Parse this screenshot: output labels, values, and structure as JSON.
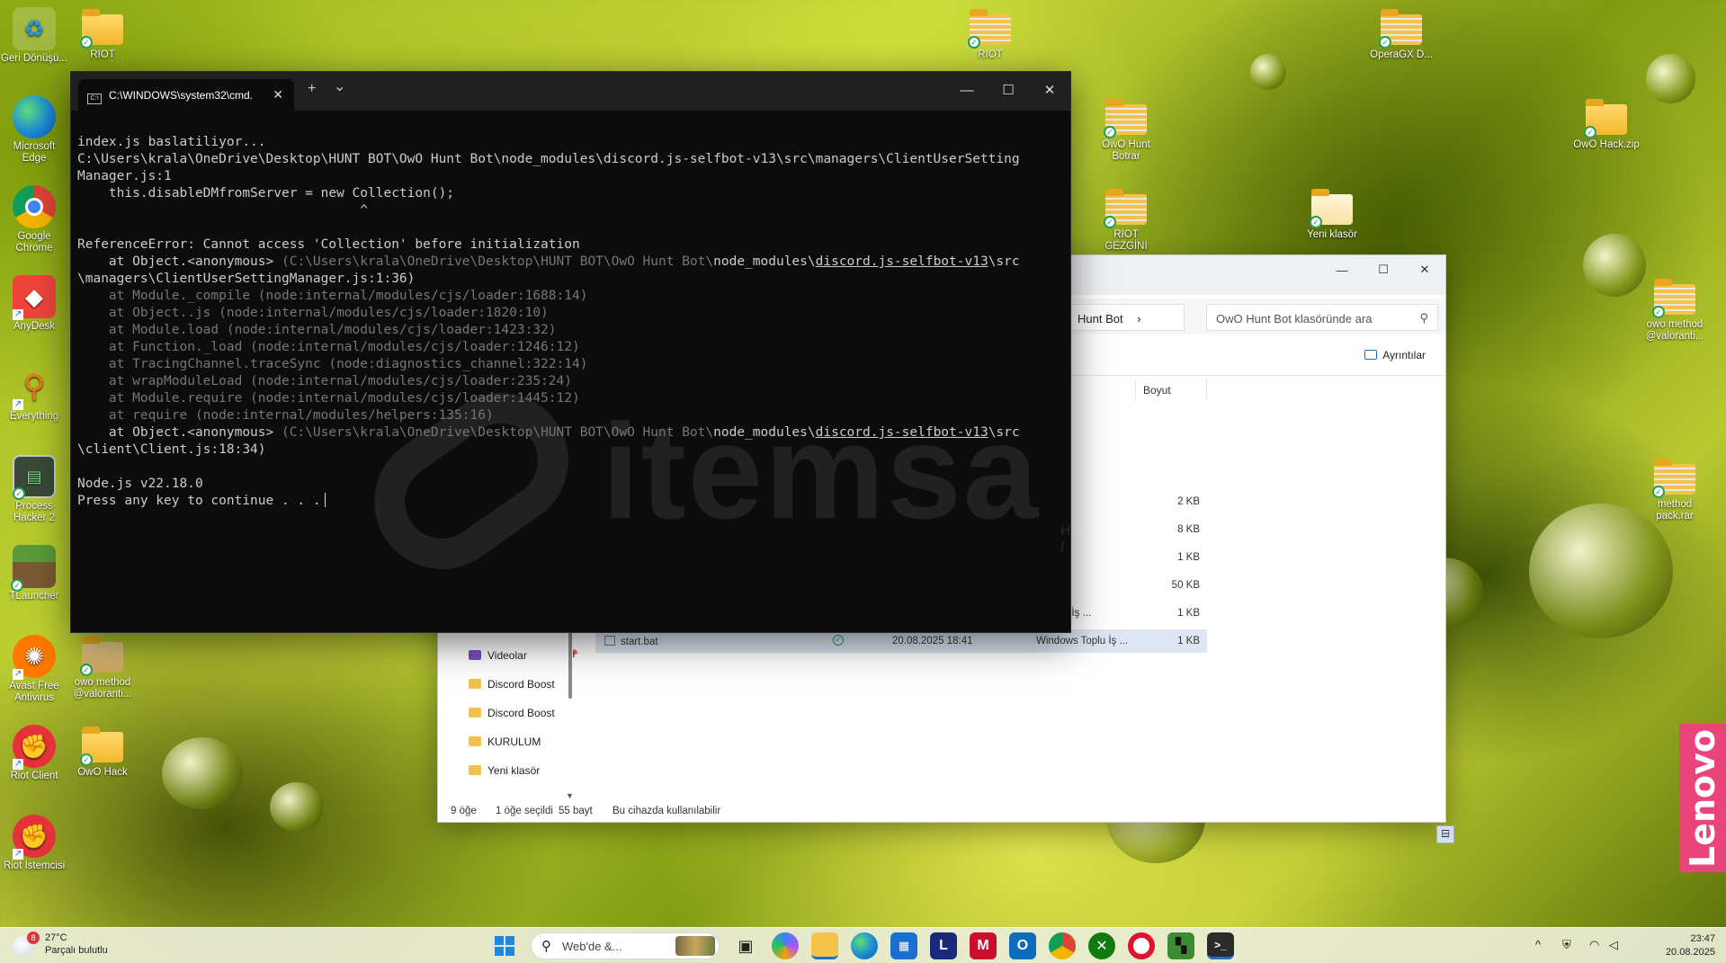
{
  "desktop": {
    "icons": [
      {
        "label": "Geri Dönüşü...",
        "kind": "recycle"
      },
      {
        "label": "Microsoft Edge",
        "kind": "edge"
      },
      {
        "label": "Google Chrome",
        "kind": "chrome"
      },
      {
        "label": "AnyDesk",
        "kind": "anydesk"
      },
      {
        "label": "Everything",
        "kind": "everything"
      },
      {
        "label": "Process Hacker 2",
        "kind": "processhacker"
      },
      {
        "label": "TLauncher",
        "kind": "tlauncher"
      },
      {
        "label": "Avast Free Antivirus",
        "kind": "avast"
      },
      {
        "label": "Riot Client",
        "kind": "riot"
      },
      {
        "label": "Riot İstemcisi",
        "kind": "riot"
      },
      {
        "label": "RIOT GEZGİNİ BOOST (1)",
        "kind": "folder"
      },
      {
        "label": "owo method @valoranti...",
        "kind": "folder"
      },
      {
        "label": "OwO Hack",
        "kind": "folder"
      },
      {
        "label": "RIOT GEZGİNİ BOOST (1).r...",
        "kind": "zip"
      },
      {
        "label": "OwO Hunt Botrar",
        "kind": "zip"
      },
      {
        "label": "RIOT GEZGİNİ BOOST (1).rar",
        "kind": "zip"
      },
      {
        "label": "Yeni klasör",
        "kind": "folder"
      },
      {
        "label": "OperaGX D...",
        "kind": "zip"
      },
      {
        "label": "OwO Hack.zip",
        "kind": "zip"
      },
      {
        "label": "owo method @valoranti...",
        "kind": "zip"
      },
      {
        "label": "method pack.rar",
        "kind": "zip"
      }
    ]
  },
  "terminal": {
    "tab_title": "C:\\WINDOWS\\system32\\cmd.",
    "tab_close": "✕",
    "new_tab": "+",
    "dropdown": "⌄",
    "minimize": "—",
    "maximize": "☐",
    "close": "✕",
    "lines": {
      "l1": "index.js baslatiliyor...",
      "l2": "C:\\Users\\krala\\OneDrive\\Desktop\\HUNT BOT\\OwO Hunt Bot\\node_modules\\discord.js-selfbot-v13\\src\\managers\\ClientUserSetting",
      "l3": "Manager.js:1",
      "l4": "    this.disableDMfromServer = new Collection();",
      "l5": "                                    ^",
      "l6": "",
      "l7": "ReferenceError: Cannot access 'Collection' before initialization",
      "l8a": "    at Object.<anonymous> ",
      "l8b": "(C:\\Users\\krala\\OneDrive\\Desktop\\HUNT BOT\\OwO Hunt Bot\\",
      "l8c": "node_modules\\",
      "l8d": "discord.js-selfbot-v13",
      "l8e": "\\src",
      "l9": "\\managers\\ClientUserSettingManager.js:1:36)",
      "l10": "    at Module._compile (node:internal/modules/cjs/loader:1688:14)",
      "l11": "    at Object..js (node:internal/modules/cjs/loader:1820:10)",
      "l12": "    at Module.load (node:internal/modules/cjs/loader:1423:32)",
      "l13": "    at Function._load (node:internal/modules/cjs/loader:1246:12)",
      "l14": "    at TracingChannel.traceSync (node:diagnostics_channel:322:14)",
      "l15": "    at wrapModuleLoad (node:internal/modules/cjs/loader:235:24)",
      "l16": "    at Module.require (node:internal/modules/cjs/loader:1445:12)",
      "l17": "    at require (node:internal/modules/helpers:135:16)",
      "l18a": "    at Object.<anonymous> ",
      "l18b": "(C:\\Users\\krala\\OneDrive\\Desktop\\HUNT BOT\\OwO Hunt Bot\\",
      "l18c": "node_modules\\",
      "l18d": "discord.js-selfbot-v13",
      "l18e": "\\src",
      "l19": "\\client\\Client.js:18:34)",
      "l20": "",
      "l21": "Node.js v22.18.0",
      "l22": "Press any key to continue . . ."
    },
    "watermark": {
      "brand": "itemsa",
      "sub": "HESAP /"
    }
  },
  "explorer": {
    "minimize": "—",
    "maximize": "☐",
    "close": "✕",
    "breadcrumb": "Hunt Bot",
    "breadcrumb_chevron": "›",
    "search_placeholder": "OwO Hunt Bot klasöründe ara",
    "details_label": "Ayrıntılar",
    "col_size": "Boyut",
    "rows": [
      {
        "type": "asörü",
        "size": ""
      },
      {
        "type": "asörü",
        "size": ""
      },
      {
        "type": "asörü",
        "size": ""
      },
      {
        "type": "yası",
        "size": "2 KB"
      },
      {
        "type": "yası",
        "size": "8 KB"
      },
      {
        "type": "osyası",
        "size": "1 KB"
      },
      {
        "type": "osyası",
        "size": "50 KB"
      },
      {
        "type": "s Toplu İş ...",
        "size": "1 KB"
      }
    ],
    "selected_row": {
      "name": "start.bat",
      "date": "20.08.2025 18:41",
      "type": "Windows Toplu İş ...",
      "size": "1 KB"
    },
    "nav": [
      {
        "label": "Videolar",
        "kind": "video"
      },
      {
        "label": "Discord Boost",
        "kind": "folder"
      },
      {
        "label": "Discord Boost",
        "kind": "folder"
      },
      {
        "label": "KURULUM",
        "kind": "folder"
      },
      {
        "label": "Yeni klasör",
        "kind": "folder"
      }
    ],
    "status": {
      "count": "9 öğe",
      "selected": "1 öğe seçildi",
      "bytes": "55 bayt",
      "availability": "Bu cihazda kullanılabilir"
    }
  },
  "lenovo": "Lenovo",
  "taskbar": {
    "weather_temp": "27°C",
    "weather_desc": "Parçalı bulutlu",
    "weather_badge": "8",
    "search_text": "Web'de &...",
    "time": "23:47",
    "date": "20.08.2025",
    "tray_up": "^"
  },
  "colors": {
    "terminal_bg": "#0c0c0c",
    "terminal_text": "#cccccc",
    "terminal_dim": "#767676",
    "accent": "#1f6fc9",
    "lenovo": "#e9457b"
  }
}
